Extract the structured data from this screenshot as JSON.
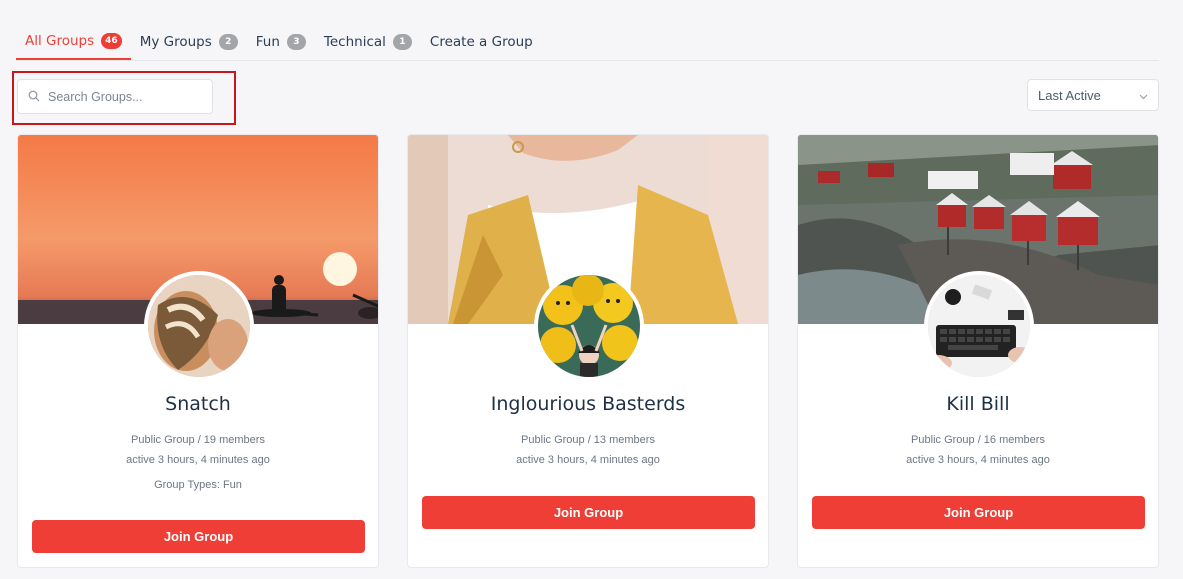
{
  "tabs": [
    {
      "label": "All Groups",
      "count": "46"
    },
    {
      "label": "My Groups",
      "count": "2"
    },
    {
      "label": "Fun",
      "count": "3"
    },
    {
      "label": "Technical",
      "count": "1"
    },
    {
      "label": "Create a Group"
    }
  ],
  "search": {
    "placeholder": "Search Groups..."
  },
  "sort": {
    "selected": "Last Active"
  },
  "groups": [
    {
      "name": "Snatch",
      "type_members": "Public Group / 19 members",
      "activity": "active 3 hours, 4 minutes ago",
      "group_types": "Group Types: Fun",
      "join_label": "Join Group"
    },
    {
      "name": "Inglourious Basterds",
      "type_members": "Public Group / 13 members",
      "activity": "active 3 hours, 4 minutes ago",
      "join_label": "Join Group"
    },
    {
      "name": "Kill Bill",
      "type_members": "Public Group / 16 members",
      "activity": "active 3 hours, 4 minutes ago",
      "join_label": "Join Group"
    }
  ],
  "colors": {
    "accent": "#ef3e36",
    "badge": "#a3a5a9",
    "highlight": "#c8161d"
  }
}
